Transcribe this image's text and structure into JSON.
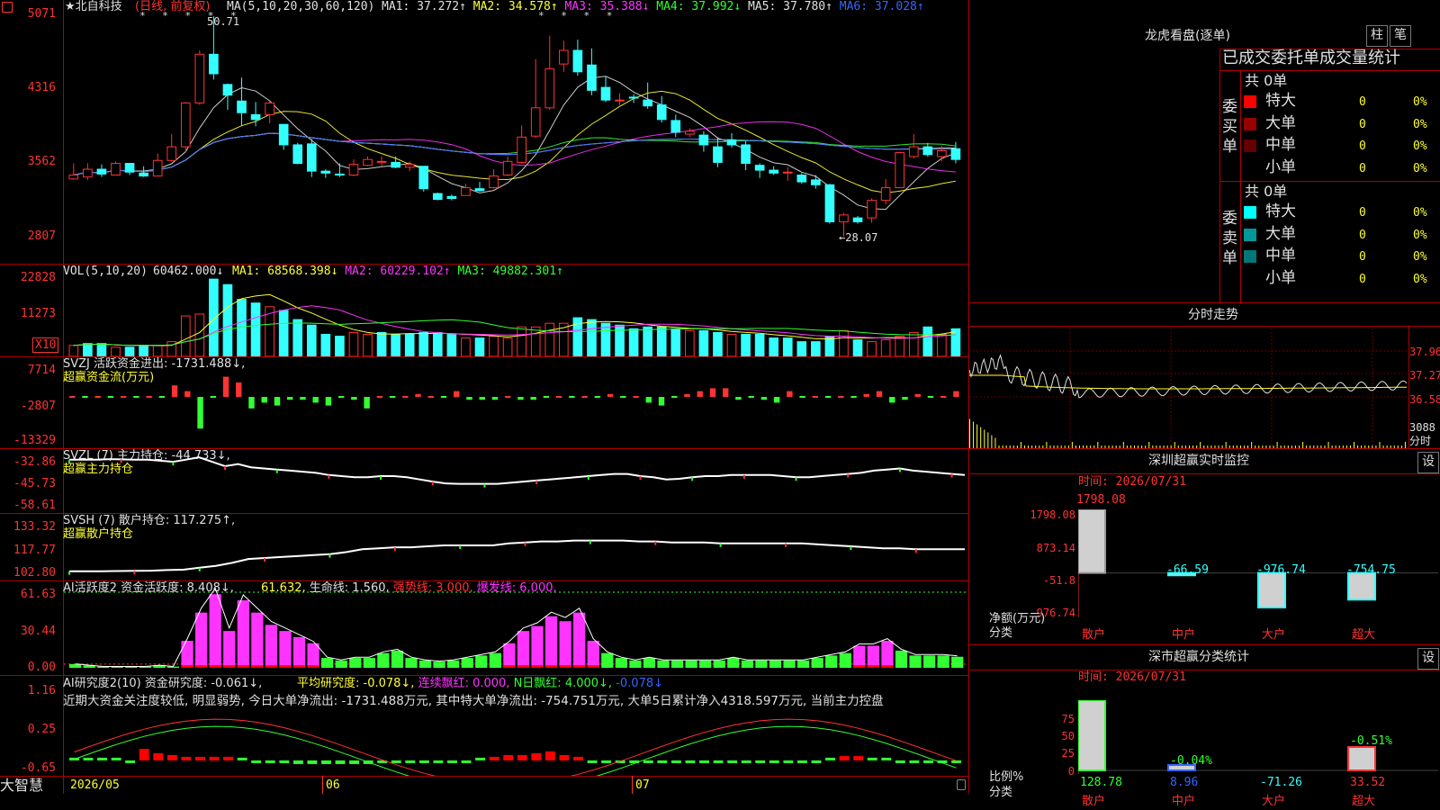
{
  "title": {
    "stock": "★北自科技",
    "mode": "(日线, 前复权)",
    "ma": {
      "lead": "MA(5,10,20,30,60,120)",
      "items": [
        {
          "label": "MA1: 37.272",
          "arrow": "↑",
          "color": "#e0e0e0"
        },
        {
          "label": "MA2: 34.578",
          "arrow": "↑",
          "color": "#ffff33"
        },
        {
          "label": "MA3: 35.388",
          "arrow": "↓",
          "color": "#ff33ff"
        },
        {
          "label": "MA4: 37.992",
          "arrow": "↓",
          "color": "#33ff33"
        },
        {
          "label": "MA5: 37.780",
          "arrow": "↑",
          "color": "#e0e0e0"
        },
        {
          "label": "MA6: 37.028",
          "arrow": "↑",
          "color": "#3366ff"
        }
      ]
    }
  },
  "price_axis": [
    "5071",
    "4316",
    "3562",
    "2807"
  ],
  "price_notes": {
    "high": "50.71",
    "low": "←28.07"
  },
  "vol": {
    "lead": "VOL(5,10,20)",
    "value": "60462.000↓",
    "items": [
      {
        "label": "MA1: 68568.398↓",
        "color": "#ffff33"
      },
      {
        "label": "MA2: 60229.102↑",
        "color": "#ff33ff"
      },
      {
        "label": "MA3: 49882.301↑",
        "color": "#33ff33"
      }
    ],
    "axis": [
      "22828",
      "11273"
    ],
    "unit": "X10"
  },
  "svzj": {
    "lead": "SVZJ  活跃资金进出: -1731.488↓,",
    "sub": "超赢资金流(万元)",
    "axis": [
      "7714",
      "-2807",
      "-13329"
    ]
  },
  "svzl": {
    "lead": "SVZL (7) 主力持仓: -44.733↓,",
    "sub": "超赢主力持仓",
    "axis": [
      "-32.86",
      "-45.73",
      "-58.61"
    ]
  },
  "svsh": {
    "lead": "SVSH (7) 散户持仓: 117.275↑,",
    "sub": "超赢散户持仓",
    "axis": [
      "133.32",
      "117.77",
      "102.80"
    ]
  },
  "ai1": {
    "lead": "AI活跃度2 资金活跃度: 8.408↓,",
    "items": [
      {
        "label": "61.632,",
        "color": "#ffff33"
      },
      {
        "label": "生命线: 1.560,",
        "color": "#e0e0e0"
      },
      {
        "label": "强势线: 3.000,",
        "color": "#ff3333"
      },
      {
        "label": "爆发线: 6.000,",
        "color": "#ff33ff"
      }
    ],
    "axis": [
      "61.63",
      "30.44",
      "0.00"
    ]
  },
  "ai2": {
    "lead": "AI研究度2(10) 资金研究度: -0.061↓,",
    "items": [
      {
        "label": "平均研究度: -0.078↓,",
        "color": "#ffff33"
      },
      {
        "label": "连续飘红: 0.000,",
        "color": "#ff33ff"
      },
      {
        "label": "N日飘红: 4.000↓,",
        "color": "#33ff33"
      },
      {
        "label": "-0.078↓",
        "color": "#3366ff"
      }
    ],
    "comment": "近期大资金关注度较低, 明显弱势, 今日大单净流出: -1731.488万元, 其中特大单净流出: -754.751万元, 大单5日累计净入4318.597万元, 当前主力控盘",
    "axis": [
      "1.16",
      "0.25",
      "-0.65"
    ]
  },
  "date_axis": [
    "2026/05",
    "06",
    "07"
  ],
  "brand": "大智慧",
  "chart_data": {
    "type": "candlestick",
    "ylim": [
      28.07,
      50.71
    ],
    "y_ticks": [
      50.71,
      43.16,
      35.62,
      28.07
    ],
    "candles": [
      [
        34.0,
        34.4,
        35.6,
        33.9
      ],
      [
        34.2,
        35.0,
        35.6,
        33.9
      ],
      [
        35.0,
        34.5,
        35.5,
        34.2
      ],
      [
        34.4,
        35.6,
        35.8,
        34.4
      ],
      [
        35.6,
        34.7,
        35.6,
        34.4
      ],
      [
        34.6,
        34.3,
        35.3,
        34.2
      ],
      [
        34.3,
        35.9,
        36.6,
        34.3
      ],
      [
        35.9,
        37.3,
        38.6,
        35.8
      ],
      [
        37.3,
        41.8,
        41.9,
        36.8
      ],
      [
        41.8,
        46.8,
        47.2,
        41.6
      ],
      [
        46.8,
        44.8,
        50.7,
        44.2
      ],
      [
        43.7,
        42.6,
        43.8,
        41.1
      ],
      [
        42.0,
        40.8,
        44.4,
        39.5
      ],
      [
        40.6,
        40.1,
        41.9,
        39.4
      ],
      [
        40.6,
        41.8,
        42.0,
        39.7
      ],
      [
        39.6,
        37.5,
        39.6,
        37.0
      ],
      [
        37.5,
        35.6,
        37.7,
        35.5
      ],
      [
        37.6,
        34.8,
        38.1,
        34.2
      ],
      [
        34.8,
        34.6,
        35.0,
        34.1
      ],
      [
        34.5,
        34.4,
        35.6,
        34.2
      ],
      [
        34.4,
        35.5,
        36.0,
        34.3
      ],
      [
        35.4,
        36.0,
        36.3,
        35.3
      ],
      [
        35.8,
        35.8,
        36.3,
        35.3
      ],
      [
        35.7,
        35.2,
        36.3,
        35.1
      ],
      [
        35.2,
        35.5,
        35.8,
        34.8
      ],
      [
        35.3,
        33.0,
        35.3,
        32.7
      ],
      [
        32.5,
        31.9,
        32.6,
        31.8
      ],
      [
        32.2,
        32.0,
        32.4,
        31.8
      ],
      [
        32.3,
        33.1,
        33.5,
        32.3
      ],
      [
        33.0,
        32.8,
        33.7,
        32.7
      ],
      [
        33.1,
        34.3,
        35.0,
        33.0
      ],
      [
        34.4,
        35.8,
        36.3,
        34.3
      ],
      [
        35.7,
        38.3,
        39.5,
        35.6
      ],
      [
        38.4,
        41.3,
        46.3,
        38.2
      ],
      [
        41.3,
        45.3,
        48.7,
        41.1
      ],
      [
        45.8,
        47.2,
        48.2,
        45.0
      ],
      [
        47.2,
        45.0,
        48.3,
        44.6
      ],
      [
        45.7,
        43.1,
        47.4,
        42.6
      ],
      [
        43.4,
        42.1,
        44.5,
        41.9
      ],
      [
        42.1,
        42.1,
        42.8,
        41.6
      ],
      [
        42.4,
        42.3,
        42.7,
        41.8
      ],
      [
        42.1,
        41.5,
        43.9,
        41.2
      ],
      [
        41.6,
        40.1,
        42.5,
        39.8
      ],
      [
        40.0,
        38.8,
        40.6,
        38.3
      ],
      [
        38.6,
        38.9,
        39.2,
        38.3
      ],
      [
        38.5,
        37.5,
        38.9,
        36.8
      ],
      [
        37.3,
        35.7,
        38.3,
        35.2
      ],
      [
        38.0,
        37.5,
        38.7,
        37.2
      ],
      [
        37.5,
        35.6,
        37.9,
        34.9
      ],
      [
        35.4,
        34.9,
        35.6,
        34.1
      ],
      [
        34.9,
        34.6,
        35.3,
        34.4
      ],
      [
        34.7,
        34.7,
        35.2,
        33.8
      ],
      [
        34.4,
        33.7,
        34.6,
        33.5
      ],
      [
        33.9,
        33.4,
        34.4,
        33.0
      ],
      [
        33.4,
        29.6,
        33.5,
        29.4
      ],
      [
        29.6,
        30.3,
        30.5,
        28.1
      ],
      [
        30.0,
        29.6,
        30.2,
        29.4
      ],
      [
        30.0,
        31.8,
        32.0,
        29.5
      ],
      [
        31.8,
        33.1,
        34.0,
        31.4
      ],
      [
        33.1,
        36.7,
        36.8,
        33.1
      ],
      [
        36.3,
        37.3,
        38.6,
        36.1
      ],
      [
        37.3,
        36.5,
        37.7,
        36.3
      ],
      [
        36.3,
        36.9,
        37.4,
        35.8
      ],
      [
        37.1,
        36.0,
        37.8,
        35.6
      ]
    ],
    "volume": [
      6,
      7,
      7,
      5,
      5,
      6,
      6,
      8,
      22,
      23,
      42,
      39,
      31,
      29,
      27,
      25,
      20,
      17,
      12,
      11,
      13,
      12,
      13,
      12,
      12,
      13,
      13,
      12,
      10,
      10,
      11,
      10,
      16,
      16,
      18,
      18,
      21,
      20,
      18,
      17,
      15,
      16,
      16,
      15,
      14,
      14,
      13,
      12,
      12,
      12,
      10,
      10,
      8,
      8,
      11,
      14,
      9,
      8,
      9,
      11,
      13,
      16,
      12,
      15
    ],
    "volume_up": [
      true,
      false,
      false,
      true,
      false,
      false,
      true,
      true,
      true,
      true,
      false,
      false,
      false,
      false,
      true,
      false,
      false,
      false,
      false,
      false,
      true,
      true,
      false,
      false,
      false,
      false,
      false,
      false,
      true,
      false,
      true,
      true,
      true,
      true,
      true,
      true,
      false,
      false,
      false,
      false,
      false,
      false,
      false,
      false,
      true,
      false,
      false,
      true,
      false,
      false,
      false,
      false,
      false,
      false,
      false,
      true,
      false,
      true,
      true,
      true,
      true,
      false,
      true,
      false
    ],
    "svzj": [
      0,
      0,
      0,
      0,
      0,
      0,
      0,
      0,
      4,
      2,
      -11,
      0,
      7,
      5,
      -4,
      -2,
      -3,
      -1,
      -1,
      -2,
      -3,
      0,
      -1,
      -4,
      0,
      0,
      0,
      1,
      0,
      0,
      2,
      -1,
      -1,
      -1,
      0,
      -1,
      -1,
      0,
      0,
      0,
      0,
      0,
      1,
      0,
      0,
      -2,
      -3,
      0,
      1,
      2,
      3,
      3,
      -1,
      0,
      -1,
      -2,
      2,
      0,
      0,
      0,
      0,
      0,
      1,
      2,
      -2,
      -1,
      1,
      0,
      0,
      2
    ],
    "svzl": [
      -36,
      -36,
      -36,
      -35.8,
      -35.9,
      -36,
      -36,
      -36.5,
      -37,
      -36,
      -35,
      -37,
      -39,
      -38,
      -39.5,
      -40,
      -40.5,
      -41,
      -41.5,
      -42,
      -43,
      -43.5,
      -44,
      -44,
      -43.5,
      -43.5,
      -44,
      -45,
      -46,
      -46.8,
      -47,
      -47,
      -47,
      -47,
      -46.5,
      -46,
      -45.5,
      -45,
      -44.5,
      -44,
      -43.5,
      -43,
      -42.5,
      -42.5,
      -43.5,
      -44,
      -45,
      -44.7,
      -44,
      -43.5,
      -43.5,
      -43,
      -43,
      -43,
      -43,
      -43.5,
      -44,
      -44,
      -43.5,
      -43,
      -42.5,
      -42,
      -41,
      -40.5,
      -40,
      -41,
      -41.5,
      -42,
      -42.5,
      -43
    ],
    "svsh": [
      105.7,
      105.7,
      105.7,
      105.8,
      105.9,
      106,
      106.3,
      106.5,
      107.5,
      108.5,
      110,
      112,
      112.5,
      113,
      113.5,
      114,
      114.5,
      115.5,
      117,
      117.5,
      118,
      118,
      118.5,
      119,
      119,
      119,
      119,
      120,
      120.5,
      121,
      121,
      121.5,
      121.5,
      121.5,
      121.5,
      121,
      121,
      120.5,
      120.5,
      120.5,
      120,
      120,
      120,
      120,
      120,
      120,
      119.5,
      119,
      118.5,
      118,
      117.5,
      117.5,
      117,
      117,
      117,
      117
    ],
    "ai_activity": [
      3,
      2,
      1,
      1,
      1,
      1,
      2,
      1,
      22,
      45,
      60,
      30,
      55,
      45,
      35,
      30,
      25,
      20,
      8,
      6,
      8,
      8,
      12,
      14,
      8,
      6,
      5,
      6,
      8,
      10,
      12,
      20,
      30,
      34,
      42,
      38,
      45,
      22,
      12,
      8,
      6,
      8,
      6,
      6,
      6,
      6,
      6,
      8,
      6,
      6,
      6,
      6,
      6,
      8,
      10,
      12,
      18,
      18,
      22,
      14,
      10,
      10,
      10,
      9
    ],
    "ai_research": [
      0.05,
      0.05,
      0.05,
      0.02,
      -0.05,
      0.32,
      0.2,
      0.15,
      0.1,
      0.1,
      0.1,
      0.1,
      0.05,
      0,
      -0.05,
      -0.05,
      -0.1,
      -0.1,
      -0.1,
      -0.1,
      -0.1,
      -0.1,
      -0.05,
      -0.05,
      -0.05,
      -0.05,
      -0.05,
      -0.05,
      0,
      0.05,
      0.1,
      0.15,
      0.15,
      0.2,
      0.25,
      0.15,
      0.1,
      -0.05,
      -0.05,
      -0.05,
      -0.05,
      -0.05,
      -0.05,
      -0.05,
      -0.05,
      -0.05,
      -0.05,
      -0.05,
      -0.05,
      -0.05,
      -0.05,
      -0.05,
      -0.05,
      0,
      0.05,
      0.12,
      0.12,
      0.05,
      0.05,
      0,
      -0.05,
      -0.05,
      -0.05,
      -0.05
    ]
  },
  "side": {
    "longhu": "龙虎看盘(逐单)",
    "btn_zhu": "柱",
    "btn_bi": "笔",
    "stat_title": "已成交委托单成交量统计",
    "buy": {
      "label": "委买单",
      "total": "共 0单",
      "rows": [
        {
          "name": "特大",
          "count": "0",
          "pct": "0%",
          "color": "#ff0000"
        },
        {
          "name": "大单",
          "count": "0",
          "pct": "0%",
          "color": "#990000"
        },
        {
          "name": "中单",
          "count": "0",
          "pct": "0%",
          "color": "#660000"
        },
        {
          "name": "小单",
          "count": "0",
          "pct": "0%",
          "color": "#000000"
        }
      ]
    },
    "sell": {
      "label": "委卖单",
      "total": "共 0单",
      "rows": [
        {
          "name": "特大",
          "count": "0",
          "pct": "0%",
          "color": "#00ffff"
        },
        {
          "name": "大单",
          "count": "0",
          "pct": "0%",
          "color": "#009999"
        },
        {
          "name": "中单",
          "count": "0",
          "pct": "0%",
          "color": "#007777"
        },
        {
          "name": "小单",
          "count": "0",
          "pct": "0%",
          "color": "#000000"
        }
      ]
    },
    "intraday": {
      "title": "分时走势",
      "axis": [
        "37.96",
        "37.27",
        "36.58"
      ],
      "vol_label": "3088",
      "vol_unit": "分时"
    },
    "monitor": {
      "title": "深圳超赢实时监控",
      "btn": "设",
      "time": "时间: 2026/07/31",
      "axis": [
        "1798.08",
        "873.14",
        "-51.8",
        "-976.74"
      ],
      "ylabel": "净额(万元)",
      "xlabel": "分类",
      "bars": [
        {
          "name": "散户",
          "value": "1798.08"
        },
        {
          "name": "中户",
          "value": "-66.59"
        },
        {
          "name": "大户",
          "value": "-976.74"
        },
        {
          "name": "超大",
          "value": "-754.75"
        }
      ]
    },
    "classify": {
      "title": "深市超赢分类统计",
      "btn": "设",
      "time": "时间: 2026/07/31",
      "axis": [
        "75",
        "50",
        "25",
        "0"
      ],
      "ylabel": "比例%",
      "xlabel": "分类",
      "bars": [
        {
          "name": "散户",
          "value": "128.78",
          "top": ""
        },
        {
          "name": "中户",
          "value": "8.96",
          "top": "-0.04%"
        },
        {
          "name": "大户",
          "value": "-71.26",
          "top": ""
        },
        {
          "name": "超大",
          "value": "33.52",
          "top": "-0.51%"
        }
      ]
    }
  }
}
